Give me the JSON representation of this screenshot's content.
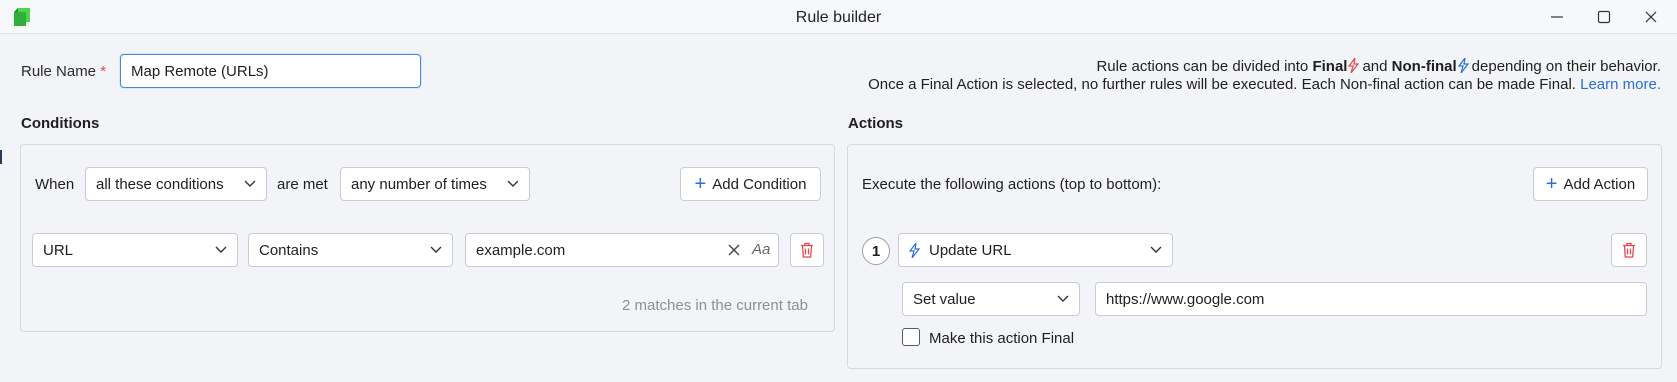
{
  "window": {
    "title": "Rule builder",
    "minimize_icon": "minimize-icon",
    "maximize_icon": "maximize-icon",
    "close_icon": "close-icon"
  },
  "rule_name": {
    "label": "Rule Name",
    "required_mark": "*",
    "value": "Map Remote (URLs)"
  },
  "info": {
    "line1_part1": "Rule actions can be divided into",
    "final_label": "Final",
    "and_text": "and",
    "nonfinal_label": "Non-final",
    "line1_part2": "depending on their behavior.",
    "line2_text": "Once a Final Action is selected, no further rules will be executed. Each Non-final action can be made Final.",
    "learn_more": "Learn more.",
    "final_color": "#e5484d",
    "nonfinal_color": "#2a6fd6"
  },
  "conditions": {
    "title": "Conditions",
    "when_label": "When",
    "match_select": "all these conditions",
    "are_met_label": "are met",
    "times_select": "any number of times",
    "add_button": "Add Condition",
    "row": {
      "field_select": "URL",
      "operator_select": "Contains",
      "value": "example.com",
      "case_toggle": "Aa"
    },
    "matches_text": "2 matches in the current tab"
  },
  "actions": {
    "title": "Actions",
    "intro": "Execute the following actions (top to bottom):",
    "add_button": "Add Action",
    "items": [
      {
        "number": "1",
        "type_select": "Update URL",
        "mode_select": "Set value",
        "value": "https://www.google.com",
        "final_checkbox_label": "Make this action Final",
        "final_checked": false
      }
    ]
  }
}
